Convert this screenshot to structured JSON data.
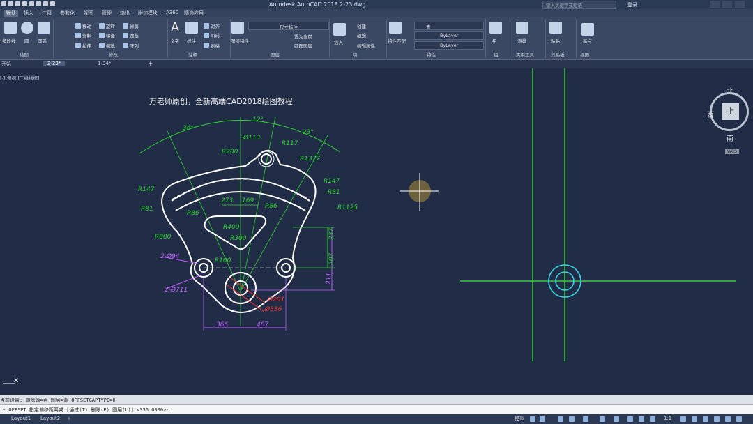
{
  "window": {
    "title": "Autodesk AutoCAD 2018    2-23.dwg",
    "search_placeholder": "键入关键字或短语",
    "login": "登录"
  },
  "ribbon_tabs": [
    "默认",
    "插入",
    "注释",
    "参数化",
    "视图",
    "管理",
    "输出",
    "附加模块",
    "A360",
    "精选应用"
  ],
  "ribbon": {
    "draw": {
      "title": "绘图",
      "polyline": "多段线",
      "circle": "圆",
      "arc": "圆弧"
    },
    "modify": {
      "title": "修改",
      "move": "移动",
      "rotate": "旋转",
      "trim": "修剪",
      "copy": "复制",
      "mirror": "镜像",
      "fillet": "圆角",
      "stretch": "拉伸",
      "scale": "缩放",
      "array": "阵列"
    },
    "annotation": {
      "title": "注释",
      "text": "文字",
      "dimension": "标注",
      "leader": "引线",
      "table": "表格",
      "align": "对齐"
    },
    "layers": {
      "title": "图层",
      "properties": "图层特性",
      "current_layer": "尺寸标注",
      "make_current": "置为当前",
      "match": "匹配图层"
    },
    "block": {
      "title": "块",
      "insert": "插入",
      "create": "创建",
      "edit": "编辑",
      "attr": "编辑属性"
    },
    "properties": {
      "title": "特性",
      "match": "特性匹配",
      "color": "青",
      "linetype": "ByLayer",
      "lineweight": "ByLayer"
    },
    "groups": {
      "title": "组",
      "group": "组"
    },
    "utilities": {
      "title": "实用工具",
      "measure": "测量"
    },
    "clipboard": {
      "title": "剪贴板",
      "paste": "粘贴"
    },
    "view": {
      "title": "视图",
      "base": "基点"
    }
  },
  "file_tabs": [
    "开始",
    "2-23*",
    "1-34*"
  ],
  "viewport_label": "[-][俯视][二维线框]",
  "drawing_title": "万老师原创，全新高端CAD2018绘图教程",
  "dims": {
    "a36": "36°",
    "a12": "12°",
    "a23": "23°",
    "r200": "R200",
    "d113": "Ø113",
    "r117": "R117",
    "r1377": "R1377",
    "r147a": "R147",
    "r81a": "R81",
    "r147b": "R147",
    "r81b": "R81",
    "r1125": "R1125",
    "r86a": "R86",
    "r86b": "R86",
    "n273": "273",
    "n169": "169",
    "r400": "R400",
    "r300": "R300",
    "r800": "R800",
    "r100": "R100",
    "n237": "237",
    "n207": "207",
    "n211": "211",
    "d94": "2-Ø94",
    "d711": "2-Ø711",
    "d201": "Ø201",
    "d336": "Ø336",
    "n366": "366",
    "n487": "487"
  },
  "viewcube": {
    "north": "北",
    "west": "西",
    "south": "南",
    "top": "上",
    "wcs": "WCS"
  },
  "command": {
    "history": "当前设置: 删除源=否  图层=源  OFFSETGAPTYPE=0",
    "prompt": "- OFFSET 指定偏移距离或 [通过(T) 删除(E) 图层(L)] <336.0000>:"
  },
  "status": {
    "layout_tabs": [
      "Layout1",
      "Layout2"
    ],
    "model": "模型",
    "scale": "1:1"
  }
}
